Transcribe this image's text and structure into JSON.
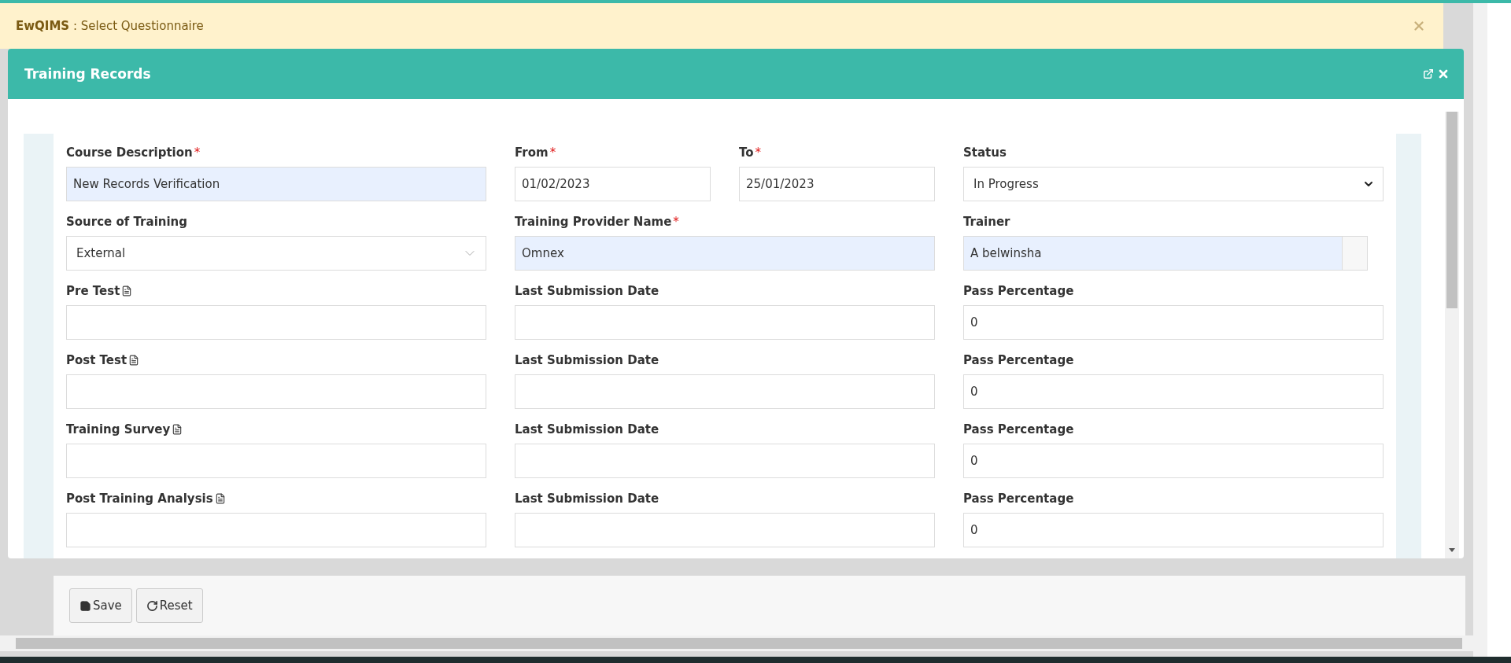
{
  "alert": {
    "text": "**EwQIMS** : Select Questionnaire"
  },
  "modal": {
    "title": "Training Records",
    "rows": [
      [
        {
          "kind": "text",
          "label": "Course Description",
          "required_mark": "*",
          "value": "New Records Verification",
          "highlighted": true
        },
        {
          "kind": "pair",
          "fields": [
            {
              "kind": "text",
              "label": "From",
              "required_mark": "*",
              "value": "01/02/2023",
              "highlighted": false
            },
            {
              "kind": "text",
              "label": "To",
              "required_mark": "*",
              "value": "25/01/2023",
              "highlighted": false
            }
          ]
        },
        {
          "kind": "select",
          "label": "Status",
          "value": "In Progress",
          "highlighted": false
        }
      ],
      [
        {
          "kind": "combo",
          "label": "Source of Training",
          "value": "External",
          "highlighted": false
        },
        {
          "kind": "text",
          "label": "Training Provider Name",
          "required_mark": "*",
          "value": "Omnex",
          "highlighted": true
        },
        {
          "kind": "lookup",
          "label": "Trainer",
          "value": "A belwinsha",
          "highlighted": true
        }
      ],
      [
        {
          "kind": "text",
          "label": "Pre Test",
          "document": true,
          "highlighted": false
        },
        {
          "kind": "text",
          "label": "Last Submission Date",
          "highlighted": false
        },
        {
          "kind": "text",
          "label": "Pass Percentage",
          "value": "0",
          "highlighted": false
        }
      ],
      [
        {
          "kind": "text",
          "label": "Post Test",
          "document": true,
          "highlighted": false
        },
        {
          "kind": "text",
          "label": "Last Submission Date",
          "highlighted": false
        },
        {
          "kind": "text",
          "label": "Pass Percentage",
          "value": "0",
          "highlighted": false
        }
      ],
      [
        {
          "kind": "text",
          "label": "Training Survey",
          "document": true,
          "highlighted": false
        },
        {
          "kind": "text",
          "label": "Last Submission Date",
          "highlighted": false
        },
        {
          "kind": "text",
          "label": "Pass Percentage",
          "value": "0",
          "highlighted": false
        }
      ],
      [
        {
          "kind": "text",
          "label": "Post Training Analysis",
          "document": true,
          "highlighted": false
        },
        {
          "kind": "text",
          "label": "Last Submission Date",
          "highlighted": false
        },
        {
          "kind": "text",
          "label": "Pass Percentage",
          "value": "0",
          "highlighted": false
        }
      ]
    ]
  },
  "buttons": [
    {
      "kind": "save",
      "label": "Save"
    },
    {
      "kind": "reset",
      "label": "Reset"
    }
  ]
}
